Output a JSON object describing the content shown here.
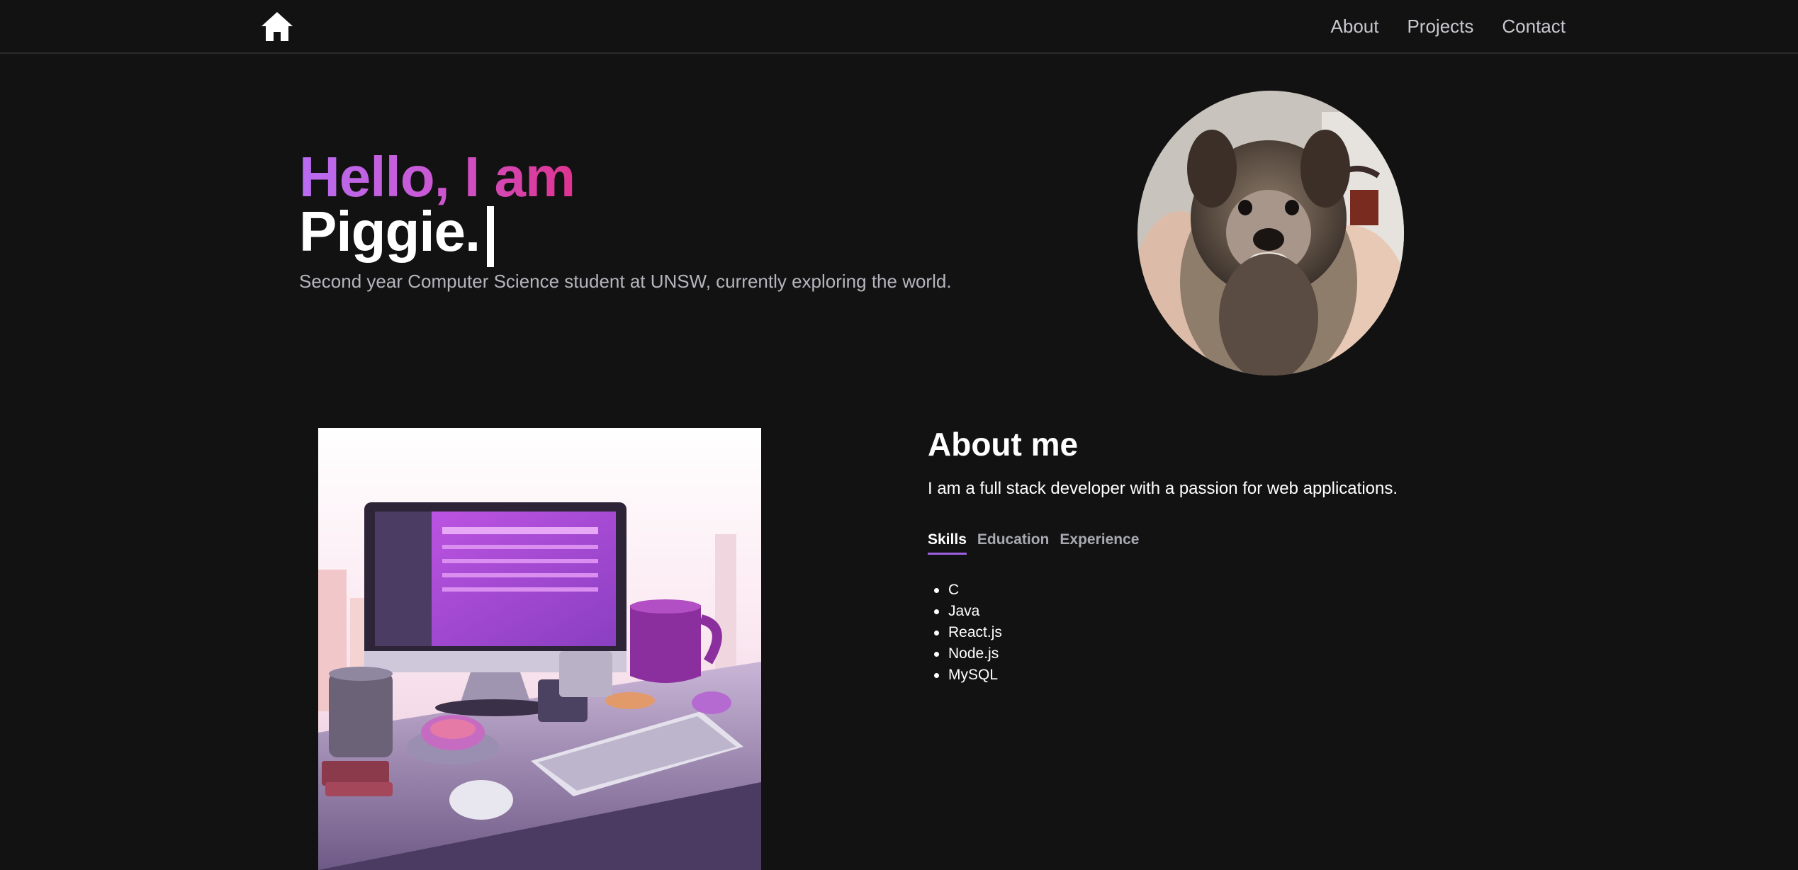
{
  "nav": {
    "home_icon": "home-icon",
    "links": [
      "About",
      "Projects",
      "Contact"
    ]
  },
  "hero": {
    "greeting": "Hello, I am",
    "name": "Piggie.",
    "subtitle": "Second year Computer Science student at UNSW, currently exploring the world.",
    "avatar": "puppy-photo"
  },
  "about": {
    "image": "desk-illustration",
    "title": "About me",
    "description": "I am a full stack developer with a passion for web applications.",
    "tabs": [
      "Skills",
      "Education",
      "Experience"
    ],
    "active_tab": "Skills",
    "skills": [
      "C",
      "Java",
      "React.js",
      "Node.js",
      "MySQL"
    ]
  },
  "colors": {
    "background": "#121212",
    "gradient_start": "#b96cf2",
    "gradient_end": "#e0338f",
    "tab_underline": "#9b5fe0"
  }
}
